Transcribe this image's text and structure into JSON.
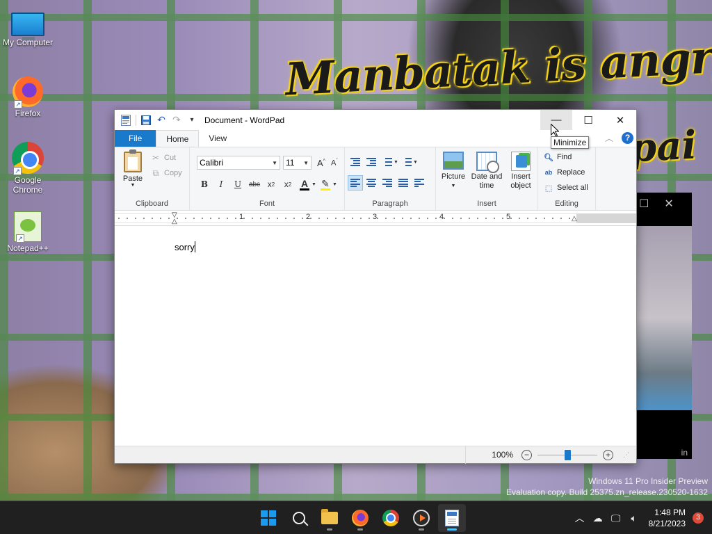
{
  "desktop": {
    "wallpaper_caption": "Manbatak is angry th",
    "wallpaper_caption2": "pai",
    "icons": [
      {
        "label": "My Computer",
        "icon": "computer-icon"
      },
      {
        "label": "Firefox",
        "icon": "firefox-icon"
      },
      {
        "label": "Google Chrome",
        "icon": "chrome-icon"
      },
      {
        "label": "Notepad++",
        "icon": "notepadpp-icon"
      }
    ],
    "watermark_line1": "Windows 11 Pro Insider Preview",
    "watermark_line2": "Evaluation copy. Build 25375.zn_release.230520-1632"
  },
  "background_window": {
    "tail_text": "in"
  },
  "wordpad": {
    "title": "Document - WordPad",
    "tabs": {
      "file": "File",
      "home": "Home",
      "view": "View"
    },
    "clipboard": {
      "paste": "Paste",
      "cut": "Cut",
      "copy": "Copy",
      "group": "Clipboard"
    },
    "font": {
      "family": "Calibri",
      "size": "11",
      "group": "Font"
    },
    "paragraph": {
      "group": "Paragraph"
    },
    "insert": {
      "picture": "Picture",
      "datetime_1": "Date and",
      "datetime_2": "time",
      "object_1": "Insert",
      "object_2": "object",
      "group": "Insert"
    },
    "editing": {
      "find": "Find",
      "replace": "Replace",
      "select_all": "Select all",
      "group": "Editing"
    },
    "ruler_numbers": [
      "1",
      "2",
      "3",
      "4",
      "5"
    ],
    "document_text": "sorry",
    "zoom_level": "100%",
    "zoom_fraction": 0.5,
    "tooltip": "Minimize"
  },
  "taskbar": {
    "apps": [
      "start",
      "search",
      "file-explorer",
      "firefox",
      "chrome",
      "media-player",
      "wordpad"
    ],
    "time": "1:48 PM",
    "date": "8/21/2023",
    "notification_count": "3"
  },
  "colors": {
    "accent": "#1979ca",
    "taskbar": "#202020",
    "ribbon": "#f5f6f7"
  }
}
